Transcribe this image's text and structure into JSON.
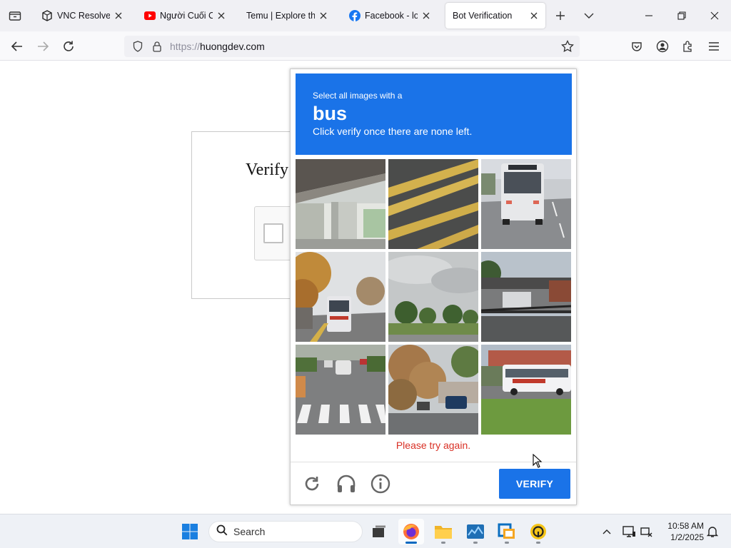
{
  "browser": {
    "tabs": [
      {
        "title": "VNC Resolver - (",
        "icon": "cube-icon"
      },
      {
        "title": "Người Cuối Cùn",
        "icon": "youtube-icon"
      },
      {
        "title": "Temu | Explore the L",
        "icon": "none"
      },
      {
        "title": "Facebook - log i",
        "icon": "facebook-icon"
      },
      {
        "title": "Bot Verification",
        "icon": "none",
        "active": true
      }
    ],
    "url_scheme": "https://",
    "url_host": "huongdev.com"
  },
  "page": {
    "verify_title": "Verify"
  },
  "captcha": {
    "instruction_line1": "Select all images with a",
    "target": "bus",
    "instruction_line2": "Click verify once there are none left.",
    "error": "Please try again.",
    "verify_label": "VERIFY",
    "tiles": [
      "overpass-pillar",
      "road-yellow-lines",
      "bus-front",
      "bus-street-autumn",
      "trees-sky",
      "bus-station",
      "crosswalk-street",
      "autumn-tree-street",
      "white-bus-side"
    ]
  },
  "taskbar": {
    "search_label": "Search",
    "time": "10:58 AM",
    "date": "1/2/2025"
  },
  "colors": {
    "accent": "#1a73e8",
    "error": "#d93025"
  }
}
